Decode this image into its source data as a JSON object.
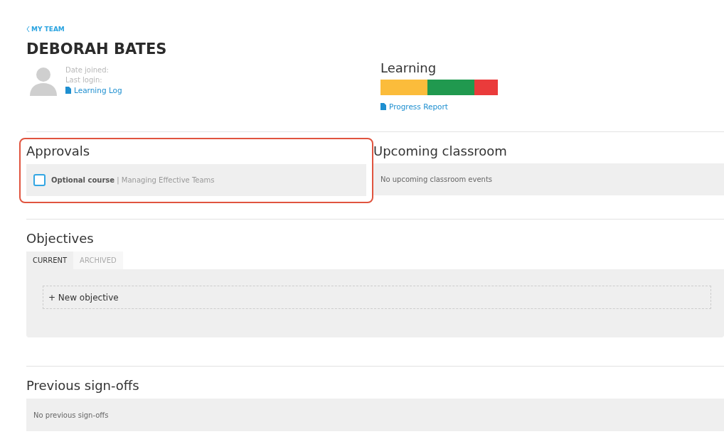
{
  "back_link": "MY TEAM",
  "person": {
    "name": "DEBORAH BATES",
    "fields": [
      "Date joined:",
      "Last login:"
    ],
    "link": "Learning Log"
  },
  "learning": {
    "title": "Learning",
    "segments": [
      {
        "color": "#fbbc3b"
      },
      {
        "color": "#20994f"
      },
      {
        "color": "#ea3b3b"
      }
    ],
    "link": "Progress Report"
  },
  "approvals": {
    "title": "Approvals",
    "highlighted": true,
    "items": [
      {
        "checked": false,
        "type": "Optional course",
        "separator": "|",
        "name": "Managing Effective Teams"
      }
    ]
  },
  "upcoming": {
    "title": "Upcoming classroom",
    "empty": "No upcoming classroom events"
  },
  "objectives": {
    "title": "Objectives",
    "tabs": [
      {
        "label": "CURRENT",
        "selected": true
      },
      {
        "label": "ARCHIVED",
        "selected": false
      }
    ],
    "new_button": "+ New objective"
  },
  "signoffs": {
    "title": "Previous sign-offs",
    "empty": "No previous sign-offs"
  }
}
